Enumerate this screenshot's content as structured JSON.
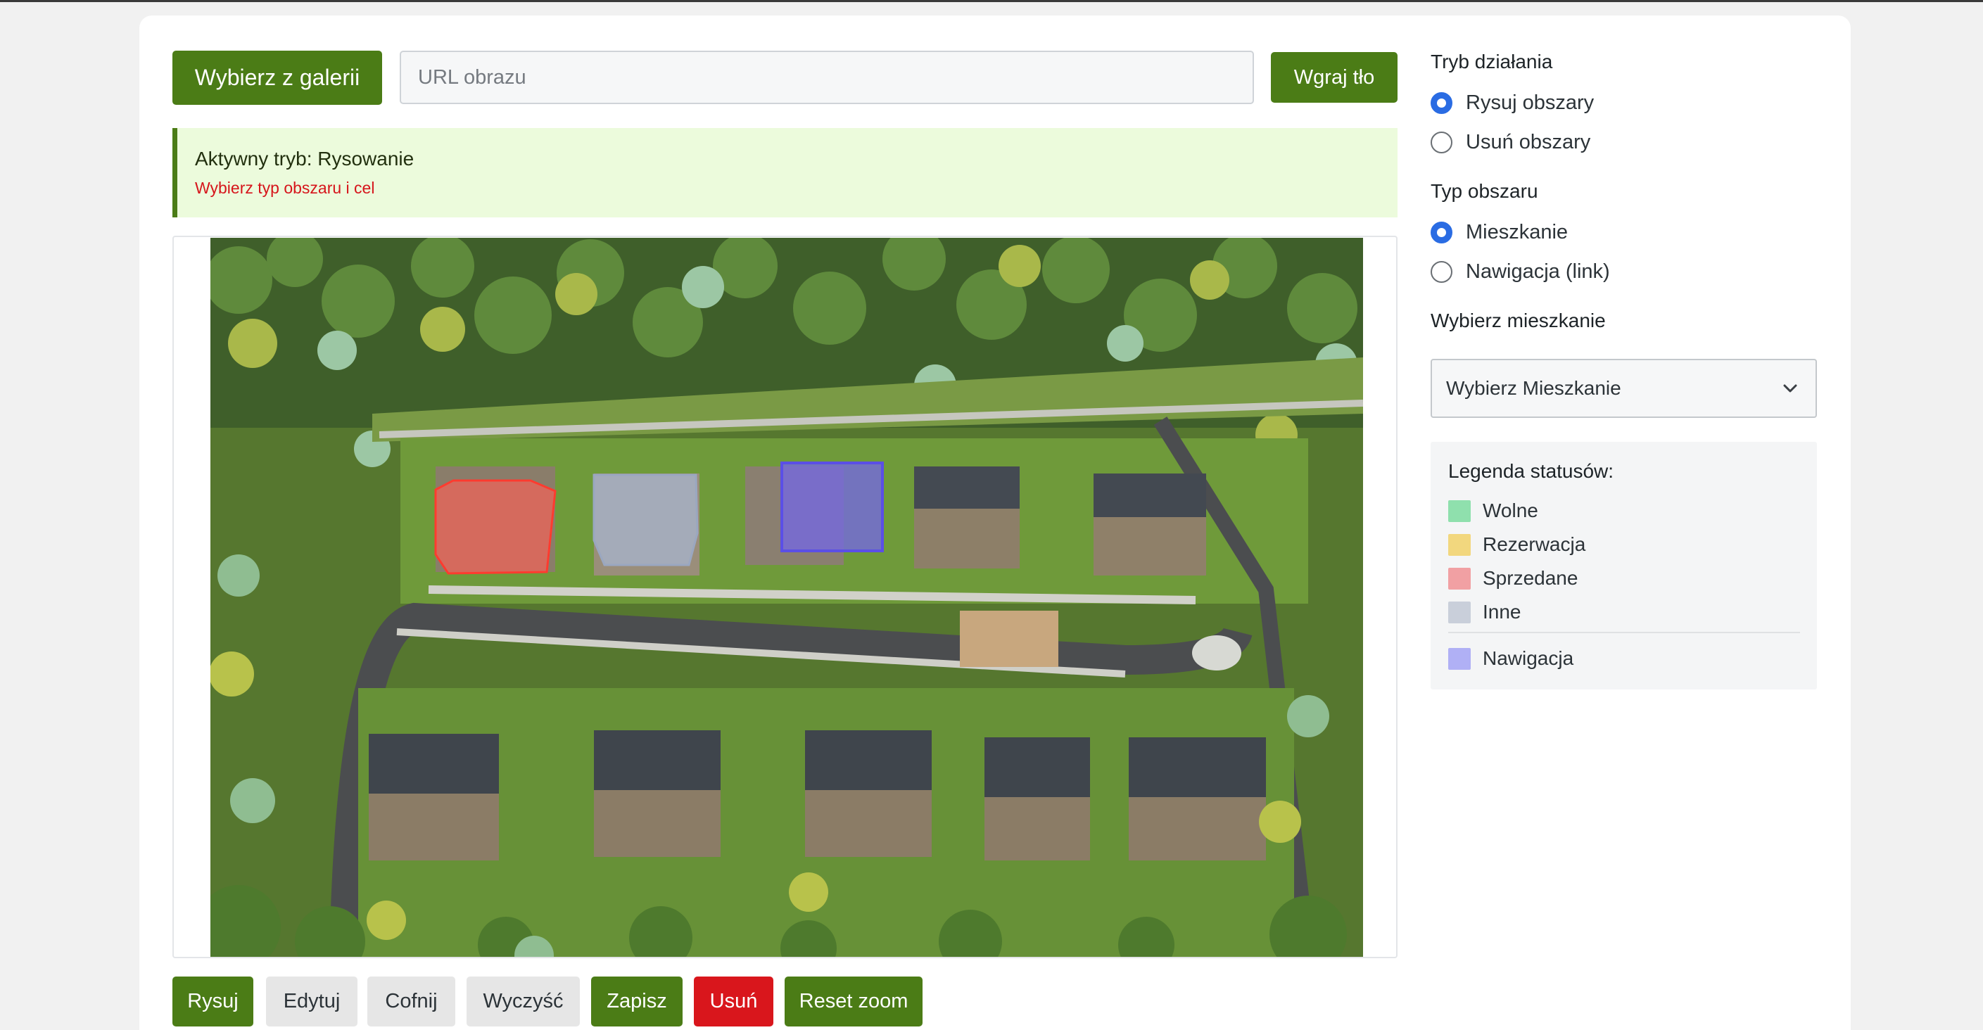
{
  "toolbar_top": {
    "gallery_button": "Wybierz z galerii",
    "url_placeholder": "URL obrazu",
    "upload_button": "Wgraj tło"
  },
  "notice": {
    "title": "Aktywny tryb: Rysowanie",
    "subtitle": "Wybierz typ obszaru i cel"
  },
  "editor_toolbar": {
    "draw": "Rysuj",
    "edit": "Edytuj",
    "undo": "Cofnij",
    "clear": "Wyczyść",
    "save": "Zapisz",
    "delete": "Usuń",
    "reset_zoom": "Reset zoom"
  },
  "sidebar": {
    "mode_heading": "Tryb działania",
    "mode_options": [
      {
        "label": "Rysuj obszary",
        "selected": true
      },
      {
        "label": "Usuń obszary",
        "selected": false
      }
    ],
    "area_type_heading": "Typ obszaru",
    "area_type_options": [
      {
        "label": "Mieszkanie",
        "selected": true
      },
      {
        "label": "Nawigacja (link)",
        "selected": false
      }
    ],
    "apartment_heading": "Wybierz mieszkanie",
    "apartment_select_value": "Wybierz Mieszkanie",
    "legend": {
      "title": "Legenda statusów:",
      "items": [
        {
          "label": "Wolne",
          "color": "#8fe0ad"
        },
        {
          "label": "Rezerwacja",
          "color": "#f2d77e"
        },
        {
          "label": "Sprzedane",
          "color": "#f1a0a3"
        },
        {
          "label": "Inne",
          "color": "#c9cfda"
        },
        {
          "label": "Nawigacja",
          "color": "#b0b0f5"
        }
      ]
    }
  },
  "colors": {
    "primary_green": "#4b7c16",
    "danger_red": "#d9161c",
    "radio_blue": "#2a6ce3",
    "notice_bg": "#ecfbdc"
  }
}
